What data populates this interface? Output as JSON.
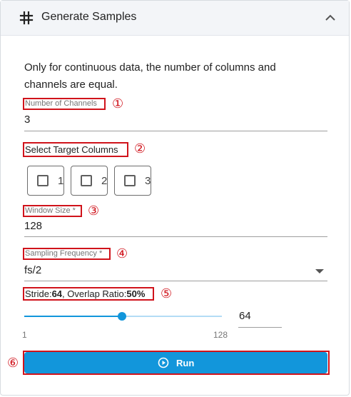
{
  "header": {
    "title": "Generate Samples",
    "left_icon": "hash-icon",
    "right_icon": "chevron-up-icon"
  },
  "info_text": "Only for continuous data, the number of columns and channels are equal.",
  "annotations": [
    "①",
    "②",
    "③",
    "④",
    "⑤",
    "⑥"
  ],
  "channels": {
    "label": "Number of Channels",
    "value": "3"
  },
  "target_columns": {
    "label": "Select Target Columns",
    "options": [
      {
        "label": "1",
        "checked": false
      },
      {
        "label": "2",
        "checked": false
      },
      {
        "label": "3",
        "checked": false
      }
    ]
  },
  "window_size": {
    "label": "Window Size *",
    "value": "128"
  },
  "sampling_frequency": {
    "label": "Sampling Frequency *",
    "value": "fs/2",
    "icon": "dropdown-arrow-icon"
  },
  "stride": {
    "stride_label": "Stride:",
    "stride_value": "64",
    "separator": ", ",
    "overlap_label": "Overlap Ratio:",
    "overlap_value": "50%"
  },
  "slider": {
    "min": "1",
    "max": "128",
    "value": "64",
    "fraction": 0.496
  },
  "run_button": {
    "label": "Run",
    "icon": "play-circle-icon"
  },
  "colors": {
    "accent": "#1296db",
    "annotation_red": "#d0131b",
    "header_bg": "#f3f5f8"
  }
}
